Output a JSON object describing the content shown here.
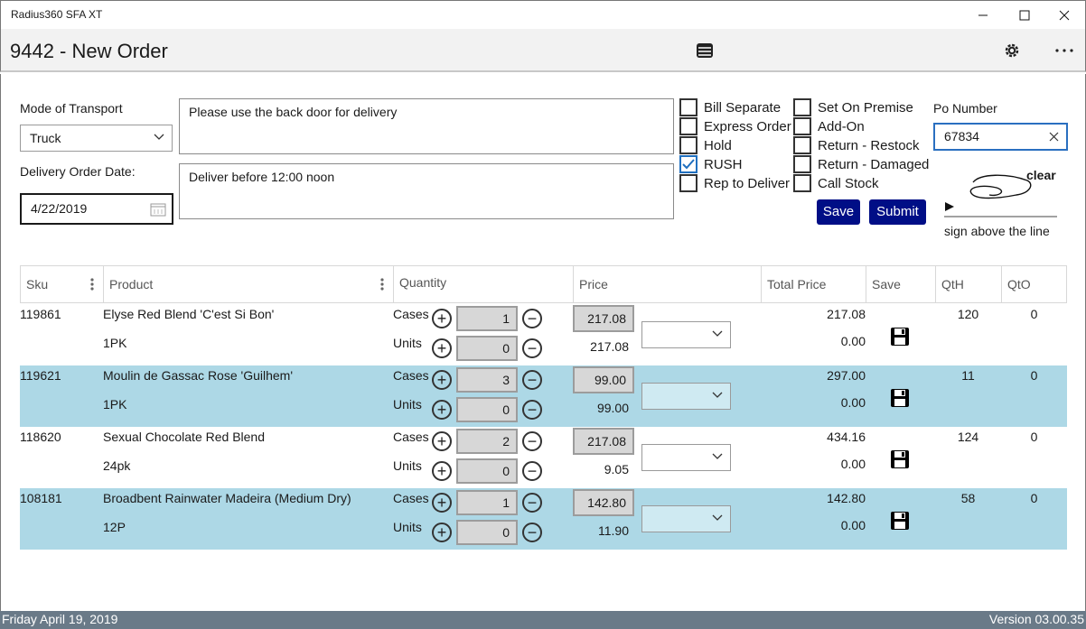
{
  "window": {
    "title": "Radius360 SFA XT",
    "minimize_icon": "minimize-icon",
    "maximize_icon": "maximize-icon",
    "close_icon": "close-icon"
  },
  "header": {
    "title": "9442 - New Order",
    "icons": [
      "list-icon",
      "gear-icon",
      "more-icon"
    ]
  },
  "form": {
    "mode_of_transport_label": "Mode of Transport",
    "mode_of_transport_value": "Truck",
    "delivery_date_label": "Delivery Order Date:",
    "delivery_date_value": "4/22/2019",
    "note1": "Please use the back door for delivery",
    "note2": "Deliver before 12:00 noon",
    "po_label": "Po Number",
    "po_value": "67834",
    "save_label": "Save",
    "submit_label": "Submit",
    "clear_label": "clear",
    "sign_label": "sign above the line"
  },
  "checkboxes_left": [
    {
      "label": "Bill Separate",
      "checked": false
    },
    {
      "label": "Express Order",
      "checked": false
    },
    {
      "label": "Hold",
      "checked": false
    },
    {
      "label": "RUSH",
      "checked": true
    },
    {
      "label": "Rep to Deliver",
      "checked": false
    }
  ],
  "checkboxes_right": [
    {
      "label": "Set On Premise",
      "checked": false
    },
    {
      "label": "Add-On",
      "checked": false
    },
    {
      "label": "Return - Restock",
      "checked": false
    },
    {
      "label": "Return - Damaged",
      "checked": false
    },
    {
      "label": "Call Stock",
      "checked": false
    }
  ],
  "table": {
    "columns": [
      "Sku",
      "Product",
      "Quantity",
      "Price",
      "Total Price",
      "Save",
      "QtH",
      "QtO"
    ],
    "cases_label": "Cases",
    "units_label": "Units",
    "rows": [
      {
        "sku": "119861",
        "product": "Elyse Red Blend 'C'est Si Bon'",
        "pack": "1PK",
        "cases": "1",
        "units": "0",
        "case_price": "217.08",
        "unit_price": "217.08",
        "total_cases": "217.08",
        "total_units": "0.00",
        "qth": "120",
        "qto": "0"
      },
      {
        "sku": "119621",
        "product": "Moulin de Gassac Rose 'Guilhem'",
        "pack": "1PK",
        "cases": "3",
        "units": "0",
        "case_price": "99.00",
        "unit_price": "99.00",
        "total_cases": "297.00",
        "total_units": "0.00",
        "qth": "11",
        "qto": "0"
      },
      {
        "sku": "118620",
        "product": "Sexual Chocolate Red Blend",
        "pack": "24pk",
        "cases": "2",
        "units": "0",
        "case_price": "217.08",
        "unit_price": "9.05",
        "total_cases": "434.16",
        "total_units": "0.00",
        "qth": "124",
        "qto": "0"
      },
      {
        "sku": "108181",
        "product": "Broadbent Rainwater Madeira (Medium Dry)",
        "pack": "12P",
        "cases": "1",
        "units": "0",
        "case_price": "142.80",
        "unit_price": "11.90",
        "total_cases": "142.80",
        "total_units": "0.00",
        "qth": "58",
        "qto": "0"
      }
    ]
  },
  "status": {
    "date": "Friday April 19, 2019",
    "version": "Version 03.00.35"
  },
  "colors": {
    "accent_button": "#000e86",
    "row_highlight": "#add8e6",
    "statusbar": "#6a7a88"
  }
}
